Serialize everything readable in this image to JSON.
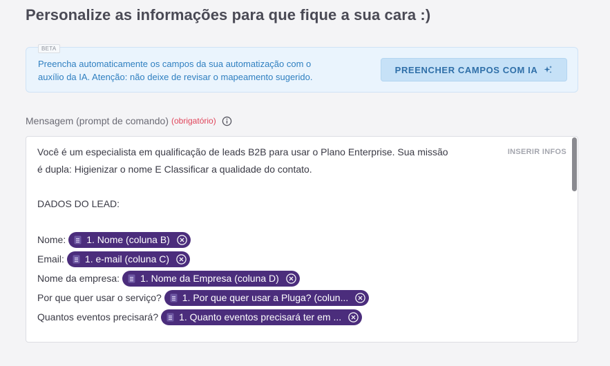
{
  "page": {
    "title": "Personalize as informações para que fique a sua cara :)"
  },
  "ai_panel": {
    "badge": "BETA",
    "line1": "Preencha automaticamente os campos da sua automatização com o",
    "line2": "auxílio da IA. Atenção: não deixe de revisar o mapeamento sugerido.",
    "button_label": "PREENCHER CAMPOS COM IA",
    "button_icon": "sparkle-icon",
    "text_color": "#2f7fc0",
    "bg_color": "#eaf4fd"
  },
  "field": {
    "label": "Mensagem (prompt de comando)",
    "required": "(obrigatório)",
    "info_icon": "info-icon",
    "insert_label": "INSERIR INFOS"
  },
  "editor": {
    "line1": "Você é um especialista em qualificação de leads B2B para usar o Plano Enterprise. Sua missão",
    "line2": "é dupla: Higienizar o nome E Classificar a qualidade do contato.",
    "section": "DADOS DO LEAD:",
    "rows": [
      {
        "label": "Nome:",
        "chip": "1. Nome (coluna B)"
      },
      {
        "label": "Email:",
        "chip": "1. e-mail (coluna C)"
      },
      {
        "label": "Nome da empresa:",
        "chip": "1. Nome da Empresa (coluna D)"
      },
      {
        "label": "Por que quer usar o serviço?",
        "chip": "1. Por que quer usar a Pluga? (colun..."
      },
      {
        "label": "Quantos eventos precisará?",
        "chip": "1. Quanto eventos precisará ter em ..."
      }
    ],
    "chip_color": "#4b2d7c"
  }
}
